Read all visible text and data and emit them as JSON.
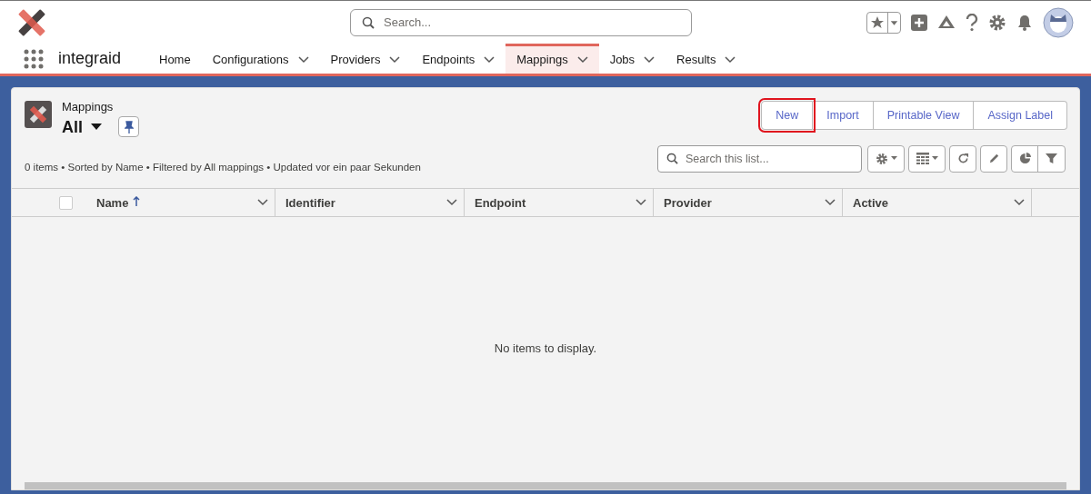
{
  "header": {
    "search": {
      "placeholder": "Search..."
    }
  },
  "nav": {
    "app_name": "integraid",
    "tabs": [
      {
        "label": "Home",
        "has_menu": false,
        "selected": false
      },
      {
        "label": "Configurations",
        "has_menu": true,
        "selected": false
      },
      {
        "label": "Providers",
        "has_menu": true,
        "selected": false
      },
      {
        "label": "Endpoints",
        "has_menu": true,
        "selected": false
      },
      {
        "label": "Mappings",
        "has_menu": true,
        "selected": true
      },
      {
        "label": "Jobs",
        "has_menu": true,
        "selected": false
      },
      {
        "label": "Results",
        "has_menu": true,
        "selected": false
      }
    ]
  },
  "list_view": {
    "object_label": "Mappings",
    "view_name": "All",
    "buttons": [
      {
        "label": "New",
        "highlighted": true
      },
      {
        "label": "Import",
        "highlighted": false
      },
      {
        "label": "Printable View",
        "highlighted": false
      },
      {
        "label": "Assign Label",
        "highlighted": false
      }
    ],
    "status": "0 items • Sorted by Name • Filtered by All mappings • Updated vor ein paar Sekunden",
    "search": {
      "placeholder": "Search this list..."
    },
    "select_all": {
      "checked": false
    },
    "columns": [
      {
        "label": "Name",
        "sorted": true
      },
      {
        "label": "Identifier",
        "sorted": false
      },
      {
        "label": "Endpoint",
        "sorted": false
      },
      {
        "label": "Provider",
        "sorted": false
      },
      {
        "label": "Active",
        "sorted": false
      }
    ],
    "empty_message": "No items to display."
  }
}
